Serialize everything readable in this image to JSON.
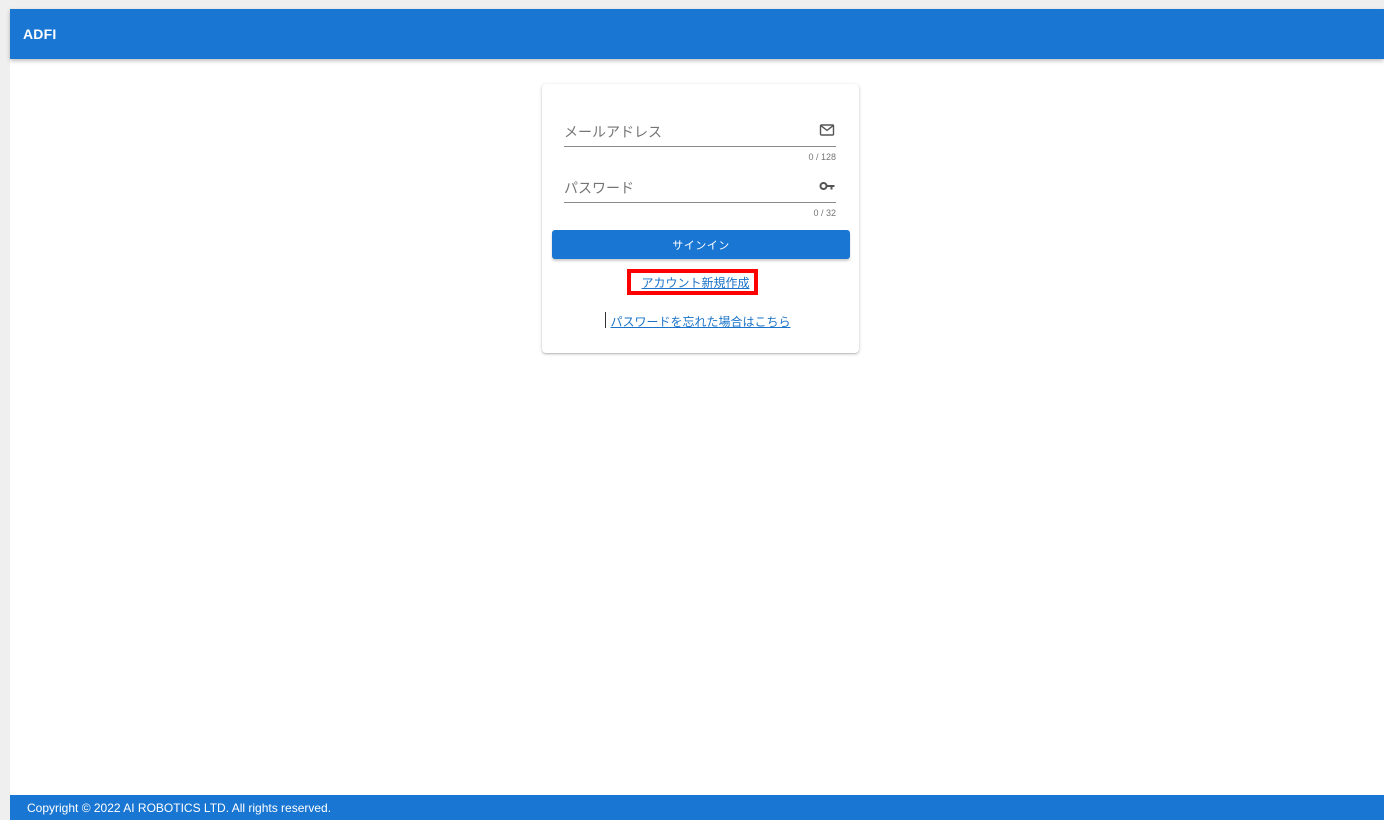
{
  "app": {
    "title": "ADFI"
  },
  "login": {
    "email": {
      "label": "メールアドレス",
      "value": "",
      "counter": "0 / 128",
      "icon": "mail-icon"
    },
    "password": {
      "label": "パスワード",
      "value": "",
      "counter": "0 / 32",
      "icon": "key-icon"
    },
    "signin_label": "サインイン",
    "create_account_label": "アカウント新規作成",
    "forgot_password_label": "パスワードを忘れた場合はこちら"
  },
  "footer": {
    "copyright": "Copyright © 2022 AI ROBOTICS LTD. All rights reserved."
  },
  "colors": {
    "primary": "#1976d2",
    "link": "#1a73c8",
    "highlight": "#ff0000"
  }
}
